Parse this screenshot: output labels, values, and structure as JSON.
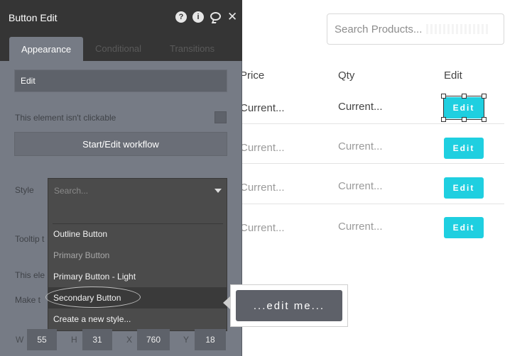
{
  "search": {
    "placeholder": "Search Products..."
  },
  "table": {
    "headers": [
      "Price",
      "Qty",
      "Edit"
    ],
    "rows": [
      {
        "price": "Current...",
        "qty": "Current...",
        "edit": "Edit"
      },
      {
        "price": "Current...",
        "qty": "Current...",
        "edit": "Edit"
      },
      {
        "price": "Current...",
        "qty": "Current...",
        "edit": "Edit"
      },
      {
        "price": "Current...",
        "qty": "Current...",
        "edit": "Edit"
      }
    ]
  },
  "panel": {
    "title": "Button Edit",
    "header_icons": [
      "help-icon",
      "info-icon",
      "comment-icon",
      "close-icon"
    ],
    "help_glyph": "?",
    "info_glyph": "i",
    "close_glyph": "✕",
    "tabs": [
      "Appearance",
      "Conditional",
      "Transitions"
    ],
    "text_value": "Edit",
    "not_clickable_label": "This element isn't clickable",
    "workflow_button": "Start/Edit workflow",
    "style_label": "Style",
    "style_search_placeholder": "Search...",
    "style_options": [
      "Outline Button",
      "Primary Button",
      "Primary Button - Light",
      "Secondary Button",
      "Create a new style..."
    ],
    "tooltip_label": "Tooltip t",
    "element_label": "This ele",
    "make_label": "Make t",
    "dimensions": [
      {
        "label": "W",
        "value": "55"
      },
      {
        "label": "H",
        "value": "31"
      },
      {
        "label": "X",
        "value": "760"
      },
      {
        "label": "Y",
        "value": "18"
      }
    ]
  },
  "callout": {
    "text": "...edit me..."
  },
  "colors": {
    "accent": "#1fcfe0",
    "panel": "#767b85",
    "header": "#353535",
    "dropdown": "#4b4b4b"
  }
}
